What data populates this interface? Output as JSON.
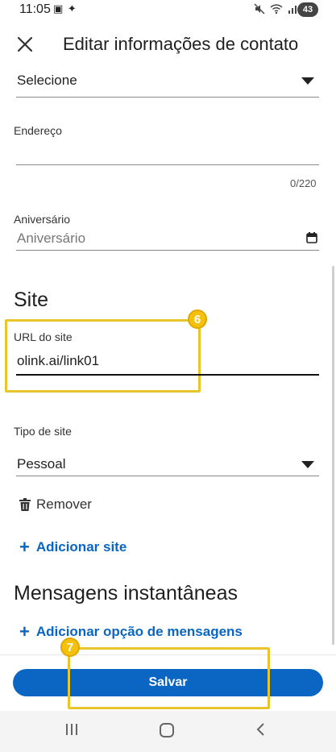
{
  "status_bar": {
    "time": "11:05",
    "left_icons": "▣ ✦",
    "battery": "43"
  },
  "header": {
    "title": "Editar informações de contato",
    "close_icon": "close-icon"
  },
  "fields": {
    "select_value": "Selecione",
    "address_label": "Endereço",
    "address_value": "",
    "address_counter": "0/220",
    "birthday_label": "Aniversário",
    "birthday_placeholder": "Aniversário"
  },
  "site_section": {
    "title": "Site",
    "url_label": "URL do site",
    "url_value": "olink.ai/link01",
    "type_label": "Tipo de site",
    "type_value": "Pessoal",
    "remove_label": "Remover",
    "add_site_label": "Adicionar site"
  },
  "messaging_section": {
    "title": "Mensagens instantâneas",
    "add_option_label": "Adicionar opção de mensagens"
  },
  "annotations": {
    "step_6": "6",
    "step_7": "7"
  },
  "footer": {
    "save_label": "Salvar"
  },
  "colors": {
    "accent": "#0a66c2",
    "highlight": "#e8c52a"
  }
}
